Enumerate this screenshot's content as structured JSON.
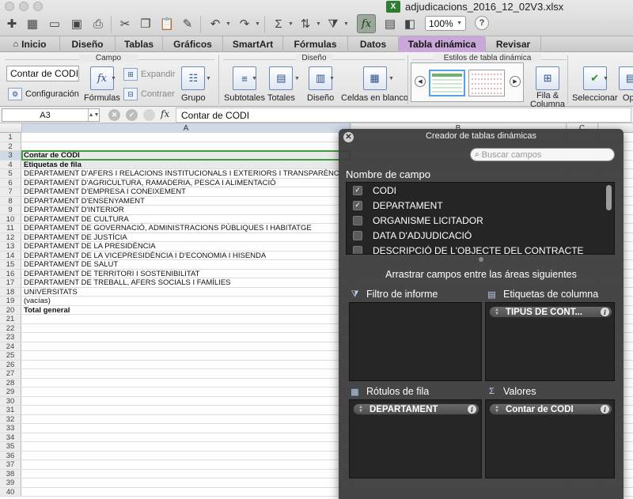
{
  "window": {
    "title": "adjudicacions_2016_12_02V3.xlsx",
    "zoom": "100%"
  },
  "tabs": [
    {
      "label": "Inicio",
      "active": false
    },
    {
      "label": "Diseño",
      "active": false
    },
    {
      "label": "Tablas",
      "active": false
    },
    {
      "label": "Gráficos",
      "active": false
    },
    {
      "label": "SmartArt",
      "active": false
    },
    {
      "label": "Fórmulas",
      "active": false
    },
    {
      "label": "Datos",
      "active": false
    },
    {
      "label": "Tabla dinámica",
      "active": true
    },
    {
      "label": "Revisar",
      "active": false
    }
  ],
  "ribbon": {
    "groups": {
      "campo": "Campo",
      "diseno": "Diseño",
      "estilos": "Estilos de tabla dinámica"
    },
    "field_name_value": "Contar de CODI",
    "configuracion": "Configuración",
    "formulas": "Fórmulas",
    "expandir": "Expandir",
    "contraer": "Contraer",
    "grupo": "Grupo",
    "subtotales": "Subtotales",
    "totales": "Totales",
    "diseno_btn": "Diseño",
    "celdas_en_blanco": "Celdas en blanco",
    "fila_columna_1": "Fila &",
    "fila_columna_2": "Columna",
    "seleccionar": "Seleccionar",
    "opciones": "Opc"
  },
  "formula_bar": {
    "cell_ref": "A3",
    "fx": "fx",
    "value": "Contar de CODI"
  },
  "columns": [
    "A",
    "B",
    "C"
  ],
  "rows": [
    {
      "n": "1",
      "a": ""
    },
    {
      "n": "2",
      "a": ""
    },
    {
      "n": "3",
      "a": "Contar de CODI"
    },
    {
      "n": "4",
      "a": "Etiquetas de fila"
    },
    {
      "n": "5",
      "a": "DEPARTAMENT D'AFERS I RELACIONS INSTITUCIONALS I EXTERIORS I TRANSPARÈNC"
    },
    {
      "n": "6",
      "a": "DEPARTAMENT D'AGRICULTURA, RAMADERIA, PESCA I ALIMENTACIÓ"
    },
    {
      "n": "7",
      "a": "DEPARTAMENT D'EMPRESA I CONEIXEMENT"
    },
    {
      "n": "8",
      "a": "DEPARTAMENT D'ENSENYAMENT"
    },
    {
      "n": "9",
      "a": "DEPARTAMENT D'INTERIOR"
    },
    {
      "n": "10",
      "a": "DEPARTAMENT DE CULTURA"
    },
    {
      "n": "11",
      "a": "DEPARTAMENT DE GOVERNACIÓ, ADMINISTRACIONS PÚBLIQUES I HABITATGE"
    },
    {
      "n": "12",
      "a": "DEPARTAMENT DE JUSTÍCIA"
    },
    {
      "n": "13",
      "a": "DEPARTAMENT DE LA PRESIDÈNCIA"
    },
    {
      "n": "14",
      "a": "DEPARTAMENT DE LA VICEPRESIDÈNCIA I D'ECONOMIA I HISENDA"
    },
    {
      "n": "15",
      "a": "DEPARTAMENT DE SALUT"
    },
    {
      "n": "16",
      "a": "DEPARTAMENT DE TERRITORI I SOSTENIBILITAT"
    },
    {
      "n": "17",
      "a": "DEPARTAMENT DE TREBALL, AFERS SOCIALS I FAMÍLIES"
    },
    {
      "n": "18",
      "a": "UNIVERSITATS"
    },
    {
      "n": "19",
      "a": "(vacías)"
    },
    {
      "n": "20",
      "a": "Total general"
    },
    {
      "n": "21",
      "a": ""
    },
    {
      "n": "22",
      "a": ""
    },
    {
      "n": "23",
      "a": ""
    },
    {
      "n": "24",
      "a": ""
    },
    {
      "n": "25",
      "a": ""
    },
    {
      "n": "26",
      "a": ""
    },
    {
      "n": "27",
      "a": ""
    },
    {
      "n": "28",
      "a": ""
    },
    {
      "n": "29",
      "a": ""
    },
    {
      "n": "30",
      "a": ""
    },
    {
      "n": "31",
      "a": ""
    },
    {
      "n": "32",
      "a": ""
    },
    {
      "n": "33",
      "a": ""
    },
    {
      "n": "34",
      "a": ""
    },
    {
      "n": "35",
      "a": ""
    },
    {
      "n": "36",
      "a": ""
    },
    {
      "n": "37",
      "a": ""
    },
    {
      "n": "38",
      "a": ""
    },
    {
      "n": "39",
      "a": ""
    },
    {
      "n": "40",
      "a": ""
    }
  ],
  "pivot_builder": {
    "title": "Creador de tablas dinámicas",
    "search_placeholder": "Buscar campos",
    "field_name_header": "Nombre de campo",
    "fields": [
      {
        "name": "CODI",
        "checked": true
      },
      {
        "name": "DEPARTAMENT",
        "checked": true
      },
      {
        "name": "ORGANISME LICITADOR",
        "checked": false
      },
      {
        "name": "DATA D'ADJUDICACIÓ",
        "checked": false
      },
      {
        "name": "DESCRIPCIÓ DE L'OBJECTE DEL CONTRACTE",
        "checked": false
      }
    ],
    "instruction": "Arrastrar campos entre las áreas siguientes",
    "areas": {
      "filter": {
        "label": "Filtro de informe",
        "items": []
      },
      "columns": {
        "label": "Etiquetas de columna",
        "items": [
          "TIPUS DE CONT..."
        ]
      },
      "rows": {
        "label": "Rótulos de fila",
        "items": [
          "DEPARTAMENT"
        ]
      },
      "values": {
        "label": "Valores",
        "items": [
          "Contar de CODI"
        ]
      }
    }
  }
}
